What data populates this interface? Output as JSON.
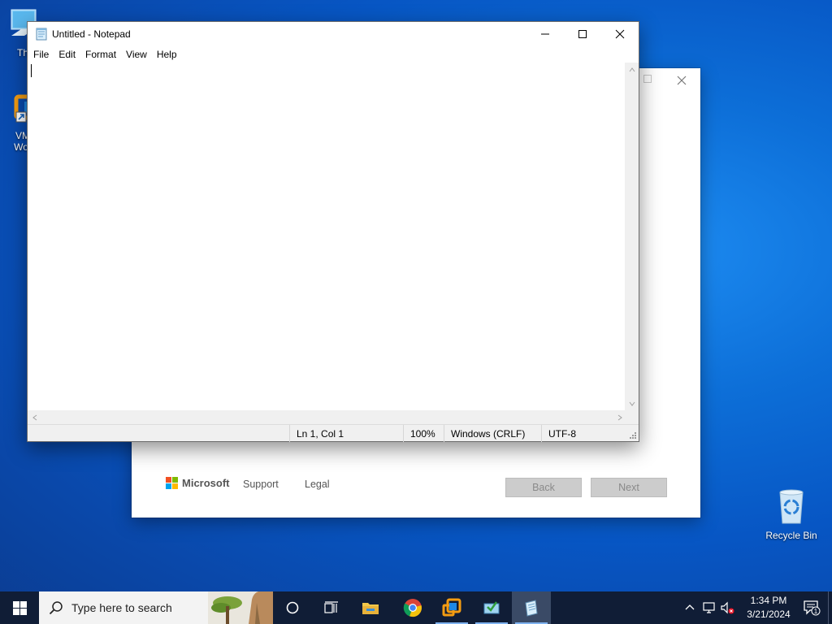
{
  "desktop": {
    "icons": [
      {
        "label": "Th",
        "icon": "this-pc-icon"
      },
      {
        "label": "VM\nWor",
        "icon": "vmware-workstation-icon"
      },
      {
        "label": "Recycle Bin",
        "icon": "recycle-bin-icon"
      }
    ]
  },
  "setup_dialog": {
    "brand": "Microsoft",
    "support_link": "Support",
    "legal_link": "Legal",
    "back_label": "Back",
    "next_label": "Next",
    "ms_colors": [
      "#f25022",
      "#7fba00",
      "#00a4ef",
      "#ffb900"
    ]
  },
  "notepad": {
    "title": "Untitled - Notepad",
    "menu": [
      "File",
      "Edit",
      "Format",
      "View",
      "Help"
    ],
    "content": "",
    "status": {
      "position": "Ln 1, Col 1",
      "zoom": "100%",
      "line_ending": "Windows (CRLF)",
      "encoding": "UTF-8"
    }
  },
  "taskbar": {
    "search_placeholder": "Type here to search",
    "apps": [
      "cortana-icon",
      "task-view-icon",
      "file-explorer-icon",
      "chrome-icon",
      "vmware-icon",
      "app-icon",
      "notepad-icon"
    ],
    "active_app": "notepad",
    "clock_time": "1:34 PM",
    "clock_date": "3/21/2024",
    "notification_count": "1"
  },
  "colors": {
    "taskbar": "#101d36",
    "desktop_accent": "#0d6fd8",
    "active_underline": "#7fb2ef"
  }
}
